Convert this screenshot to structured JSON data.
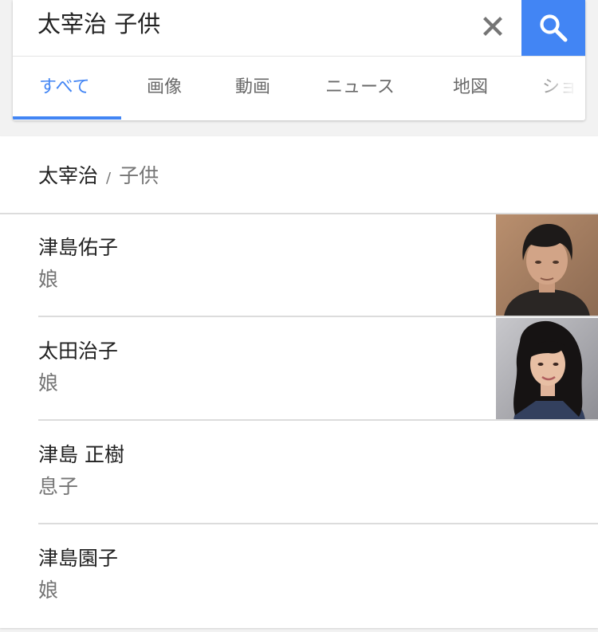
{
  "search": {
    "query": "太宰治 子供"
  },
  "tabs": [
    {
      "label": "すべて",
      "active": true
    },
    {
      "label": "画像",
      "active": false
    },
    {
      "label": "動画",
      "active": false
    },
    {
      "label": "ニュース",
      "active": false
    },
    {
      "label": "地図",
      "active": false
    },
    {
      "label": "ショ",
      "active": false
    }
  ],
  "breadcrumb": {
    "entity": "太宰治",
    "separator": "/",
    "attribute": "子供"
  },
  "children": [
    {
      "name": "津島佑子",
      "relation": "娘",
      "has_photo": true
    },
    {
      "name": "太田治子",
      "relation": "娘",
      "has_photo": true
    },
    {
      "name": "津島 正樹",
      "relation": "息子",
      "has_photo": false
    },
    {
      "name": "津島園子",
      "relation": "娘",
      "has_photo": false
    }
  ],
  "colors": {
    "accent": "#4285f4",
    "text_primary": "#222222",
    "text_secondary": "#757575",
    "tab_inactive": "#6a6a6a",
    "background": "#f2f2f2"
  },
  "icons": {
    "clear": "close-icon",
    "search": "search-icon"
  }
}
